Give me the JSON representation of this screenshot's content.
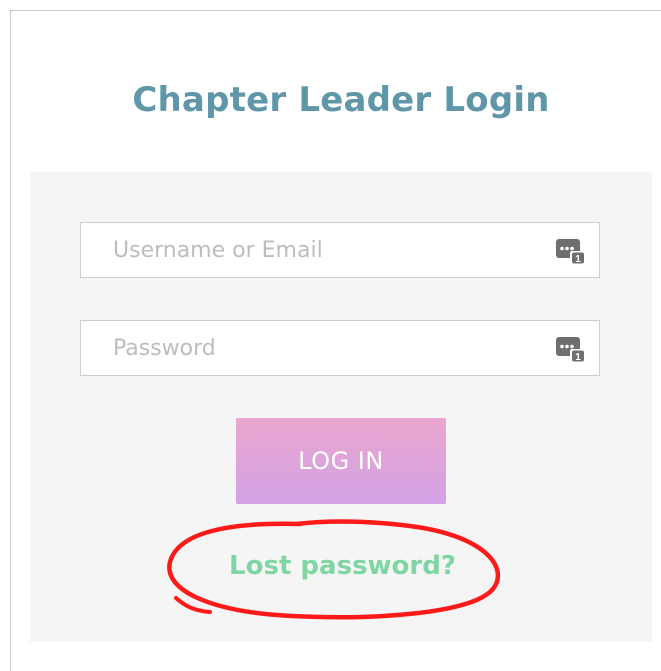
{
  "login_box": {
    "title": "Chapter Leader Login",
    "username": {
      "placeholder": "Username or Email",
      "value": "",
      "icon": "password-manager-icon"
    },
    "password": {
      "placeholder": "Password",
      "value": "",
      "icon": "password-manager-icon"
    },
    "login_label": "LOG IN",
    "lost_password_label": "Lost password?"
  },
  "colors": {
    "title": "#5f97a9",
    "panel_background": "#f5f5f5",
    "button_gradient_top": "#eaa6ce",
    "button_gradient_bottom": "#d3a2e6",
    "link": "#7fd6a4",
    "annotation": "#ff1a1a"
  },
  "annotation": {
    "type": "hand-drawn-circle",
    "target": "lost-password-link"
  }
}
